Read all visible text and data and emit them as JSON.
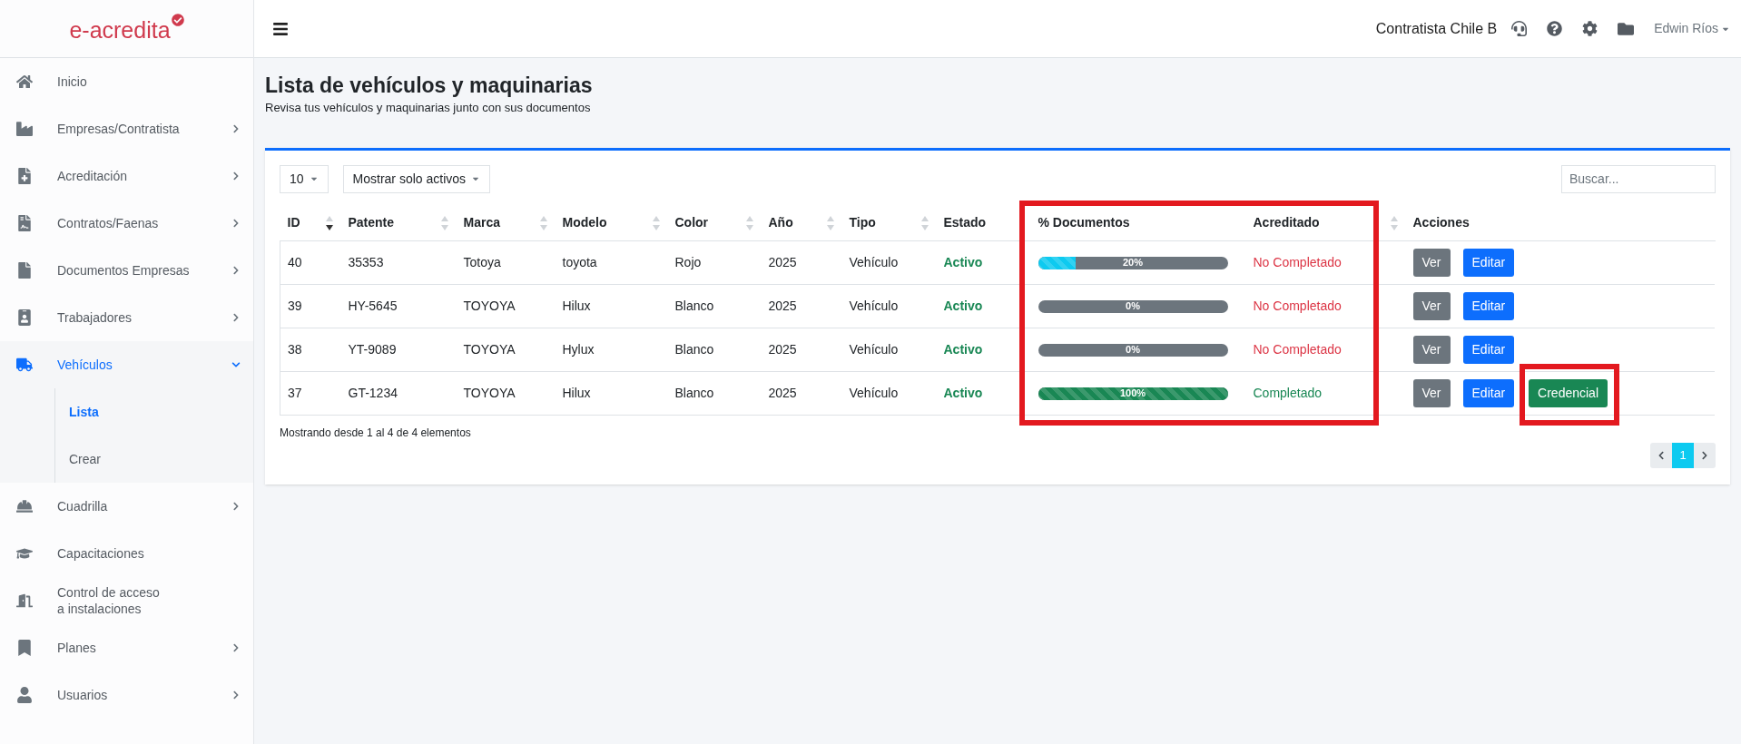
{
  "logo": {
    "text": "e-acredita"
  },
  "header": {
    "company": "Contratista Chile B",
    "user": "Edwin Ríos"
  },
  "sidebar": {
    "items": [
      {
        "label": "Inicio",
        "has_children": false,
        "selected": false
      },
      {
        "label": "Empresas/Contratista",
        "has_children": true,
        "expanded": false,
        "selected": false
      },
      {
        "label": "Acreditación",
        "has_children": true,
        "expanded": false,
        "selected": false
      },
      {
        "label": "Contratos/Faenas",
        "has_children": true,
        "expanded": false,
        "selected": false
      },
      {
        "label": "Documentos Empresas",
        "has_children": true,
        "expanded": false,
        "selected": false
      },
      {
        "label": "Trabajadores",
        "has_children": true,
        "expanded": false,
        "selected": false
      },
      {
        "label": "Vehículos",
        "has_children": true,
        "expanded": true,
        "selected": true,
        "children": [
          {
            "label": "Lista",
            "selected": true
          },
          {
            "label": "Crear",
            "selected": false
          }
        ]
      },
      {
        "label": "Cuadrilla",
        "has_children": true,
        "expanded": false,
        "selected": false
      },
      {
        "label": "Capacitaciones",
        "has_children": false,
        "selected": false
      },
      {
        "label": "Control de acceso\na instalaciones",
        "has_children": false,
        "selected": false
      },
      {
        "label": "Planes",
        "has_children": true,
        "expanded": false,
        "selected": false
      },
      {
        "label": "Usuarios",
        "has_children": true,
        "expanded": false,
        "selected": false
      }
    ]
  },
  "page": {
    "title": "Lista de vehículos y maquinarias",
    "subtitle": "Revisa tus vehículos y maquinarias junto con sus documentos"
  },
  "toolbar": {
    "page_size": "10",
    "filter": "Mostrar solo activos",
    "search": {
      "placeholder": "Buscar..."
    }
  },
  "table": {
    "columns": [
      {
        "label": "ID",
        "sortable": true,
        "sorted": true
      },
      {
        "label": "Patente",
        "sortable": true,
        "sorted": false
      },
      {
        "label": "Marca",
        "sortable": true,
        "sorted": false
      },
      {
        "label": "Modelo",
        "sortable": true,
        "sorted": false
      },
      {
        "label": "Color",
        "sortable": true,
        "sorted": false
      },
      {
        "label": "Año",
        "sortable": true,
        "sorted": false
      },
      {
        "label": "Tipo",
        "sortable": true,
        "sorted": false
      },
      {
        "label": "Estado",
        "sortable": false
      },
      {
        "label": "% Documentos",
        "sortable": false
      },
      {
        "label": "Acreditado",
        "sortable": true,
        "sorted": false
      },
      {
        "label": "Acciones",
        "sortable": false
      }
    ],
    "rows": [
      {
        "id": "40",
        "patente": "35353",
        "marca": "Totoya",
        "modelo": "toyota",
        "color_name": "Rojo",
        "anio": "2025",
        "tipo": "Vehículo",
        "estado": "Activo",
        "docs": {
          "level": 0.2,
          "label": "20%",
          "color": "#0dcaf0"
        },
        "acreditado": {
          "text": "No Completado",
          "complete": false
        },
        "actions": [
          {
            "label": "Ver",
            "kind": "view"
          },
          {
            "label": "Editar",
            "kind": "edit"
          }
        ]
      },
      {
        "id": "39",
        "patente": "HY-5645",
        "marca": "TOYOYA",
        "modelo": "Hilux",
        "color_name": "Blanco",
        "anio": "2025",
        "tipo": "Vehículo",
        "estado": "Activo",
        "docs": {
          "level": 0,
          "label": "0%"
        },
        "acreditado": {
          "text": "No Completado",
          "complete": false
        },
        "actions": [
          {
            "label": "Ver",
            "kind": "view"
          },
          {
            "label": "Editar",
            "kind": "edit"
          }
        ]
      },
      {
        "id": "38",
        "patente": "YT-9089",
        "marca": "TOYOYA",
        "modelo": "Hylux",
        "color_name": "Blanco",
        "anio": "2025",
        "tipo": "Vehículo",
        "estado": "Activo",
        "docs": {
          "level": 0,
          "label": "0%"
        },
        "acreditado": {
          "text": "No Completado",
          "complete": false
        },
        "actions": [
          {
            "label": "Ver",
            "kind": "view"
          },
          {
            "label": "Editar",
            "kind": "edit"
          }
        ]
      },
      {
        "id": "37",
        "patente": "GT-1234",
        "marca": "TOYOYA",
        "modelo": "Hilux",
        "color_name": "Blanco",
        "anio": "2025",
        "tipo": "Vehículo",
        "estado": "Activo",
        "docs": {
          "level": 1,
          "label": "100%",
          "color": "#198754"
        },
        "acreditado": {
          "text": "Completado",
          "complete": true
        },
        "actions": [
          {
            "label": "Ver",
            "kind": "view"
          },
          {
            "label": "Editar",
            "kind": "edit"
          },
          {
            "label": "Credencial",
            "kind": "credential"
          }
        ]
      }
    ]
  },
  "footer": {
    "info": "Mostrando desde 1 al 4 de 4 elementos"
  },
  "pagination": {
    "pages": [
      {
        "label": "1",
        "selected": true
      }
    ]
  }
}
